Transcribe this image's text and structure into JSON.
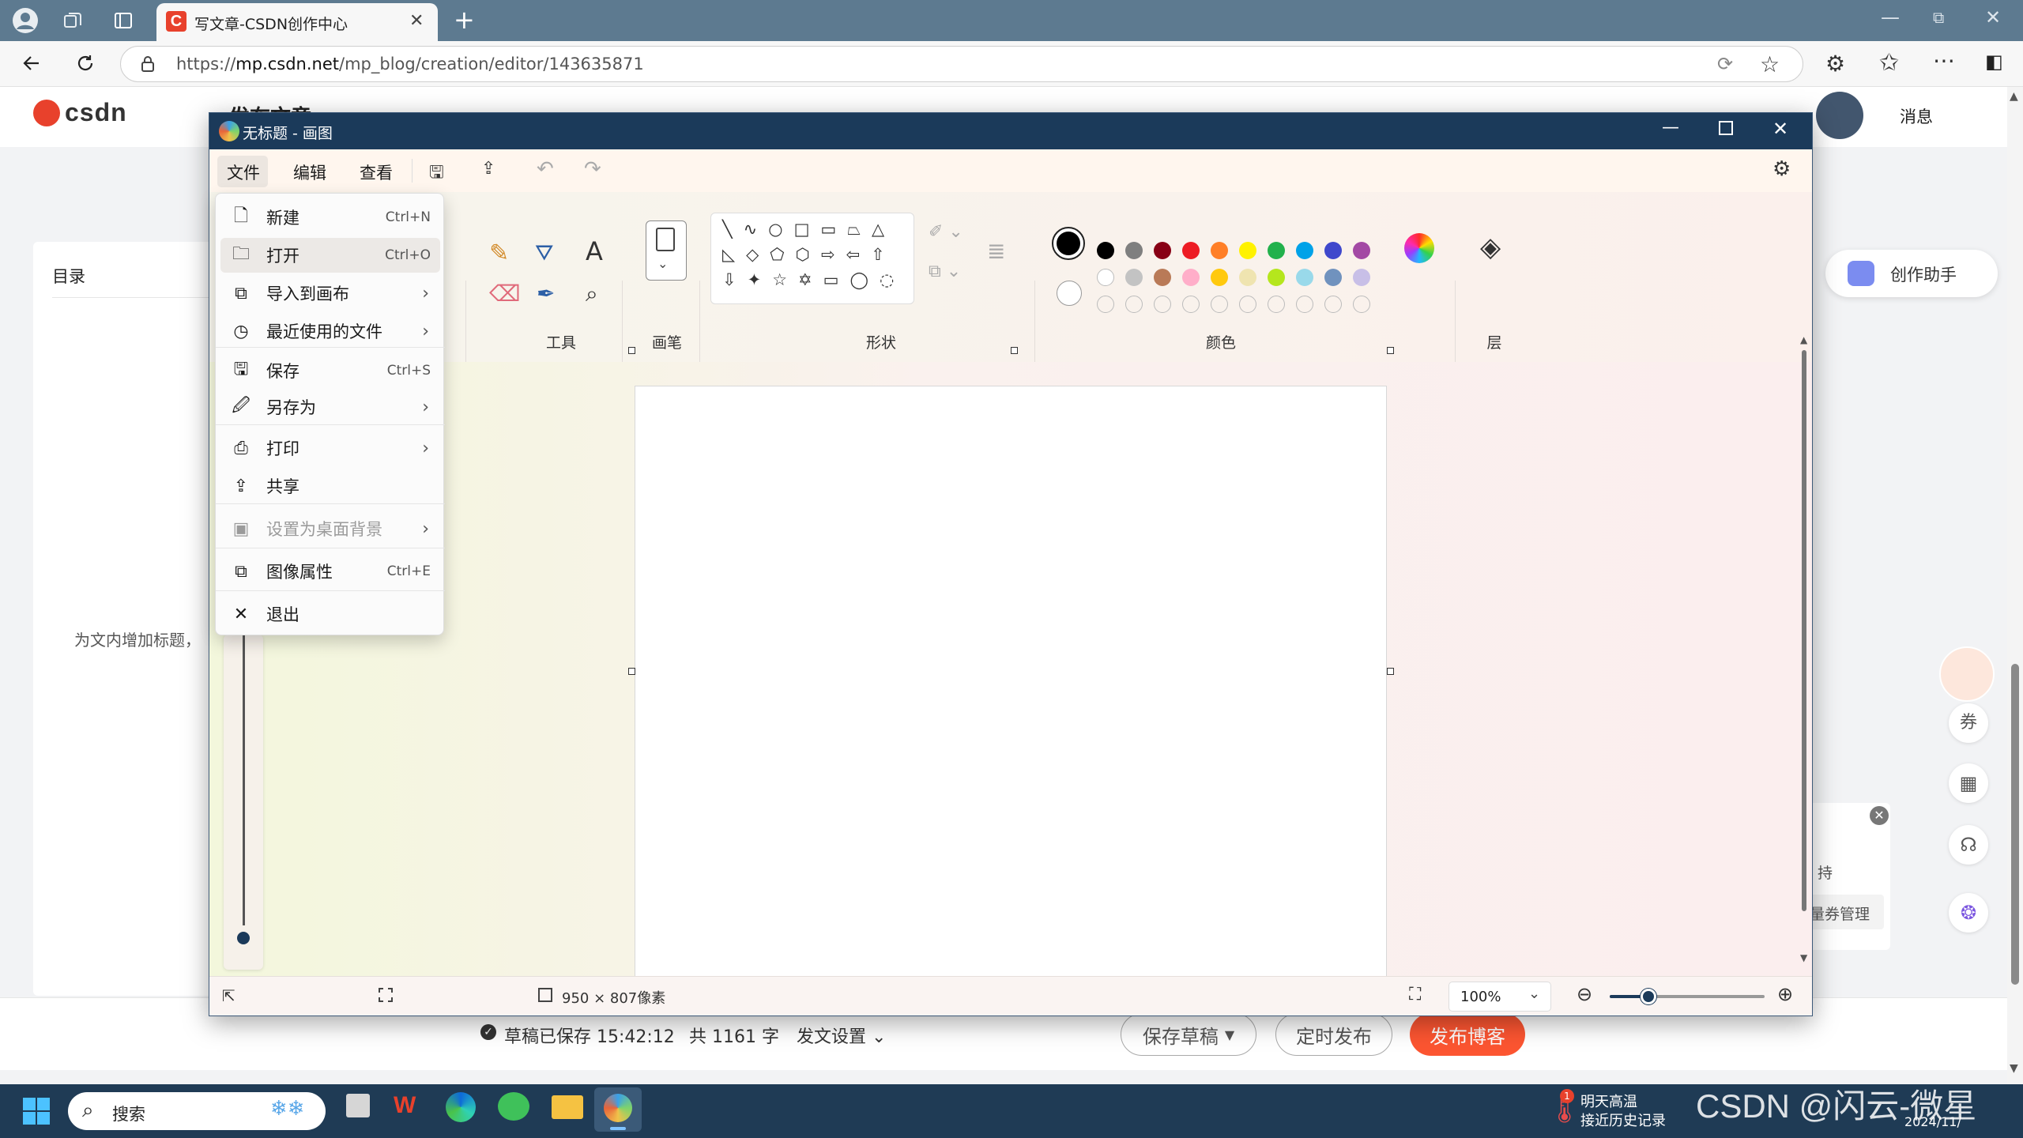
{
  "browser": {
    "tab_title": "写文章-CSDN创作中心",
    "url_prefix": "https://",
    "url_host": "mp.csdn.net",
    "url_path": "/mp_blog/creation/editor/143635871"
  },
  "csdn": {
    "logo_text": "CSDN",
    "header_title_partial": "发布文章",
    "messages": "消息",
    "toc_title": "目录",
    "add_heading_hint": "为文内增加标题，",
    "assistant": "创作助手",
    "popup_text1": "持",
    "popup_text2": "量券管理",
    "footer": {
      "saved_status": "草稿已保存 15:42:12",
      "word_count": "共 1161 字",
      "post_settings": "发文设置",
      "save_draft": "保存草稿",
      "schedule": "定时发布",
      "publish": "发布博客"
    }
  },
  "paint": {
    "title": "无标题 - 画图",
    "menu": [
      "文件",
      "编辑",
      "查看"
    ],
    "groups": {
      "tools": "工具",
      "brushes": "画笔",
      "shapes": "形状",
      "colors": "颜色",
      "layers": "层"
    },
    "status": {
      "canvas_size": "950 × 807像素",
      "zoom": "100%"
    },
    "zoom_slider_fraction": 0.25,
    "palette_row1": [
      "#000000",
      "#7f7f7f",
      "#880015",
      "#ed1c24",
      "#ff7f27",
      "#fff200",
      "#22b14c",
      "#00a2e8",
      "#3f48cc",
      "#a349a4"
    ],
    "palette_row2": [
      "#ffffff",
      "#c3c3c3",
      "#b97a57",
      "#ffaec9",
      "#ffc90e",
      "#efe4b0",
      "#b5e61d",
      "#99d9ea",
      "#7092be",
      "#c8bfe7"
    ],
    "file_menu": [
      {
        "label": "新建",
        "shortcut": "Ctrl+N",
        "icon": "new-file-icon"
      },
      {
        "label": "打开",
        "shortcut": "Ctrl+O",
        "icon": "folder-open-icon"
      },
      {
        "label": "导入到画布",
        "submenu": true,
        "icon": "import-image-icon"
      },
      {
        "label": "最近使用的文件",
        "submenu": true,
        "icon": "clock-icon"
      },
      {
        "label": "保存",
        "shortcut": "Ctrl+S",
        "icon": "save-icon"
      },
      {
        "label": "另存为",
        "submenu": true,
        "icon": "save-as-icon"
      },
      {
        "label": "打印",
        "submenu": true,
        "icon": "printer-icon"
      },
      {
        "label": "共享",
        "icon": "share-icon"
      },
      {
        "label": "设置为桌面背景",
        "submenu": true,
        "disabled": true,
        "icon": "wallpaper-icon"
      },
      {
        "label": "图像属性",
        "shortcut": "Ctrl+E",
        "icon": "image-properties-icon"
      },
      {
        "label": "退出",
        "icon": "close-icon"
      }
    ]
  },
  "taskbar": {
    "search_placeholder": "搜索",
    "weather_title": "明天高温",
    "weather_sub": "接近历史记录",
    "weather_badge": "1",
    "date_partial": "2024/11/",
    "watermark": "CSDN @闪云-微星"
  }
}
